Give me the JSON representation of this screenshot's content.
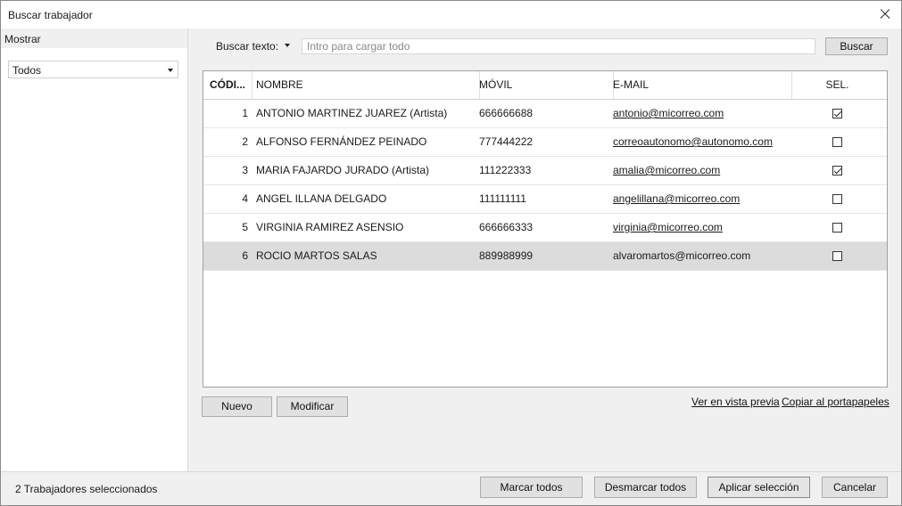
{
  "window": {
    "title": "Buscar trabajador"
  },
  "sidebar": {
    "heading": "Mostrar",
    "filter_value": "Todos"
  },
  "search": {
    "label": "Buscar texto:",
    "placeholder": "Intro para cargar todo",
    "button": "Buscar"
  },
  "table": {
    "headers": {
      "code": "CÓDI...",
      "name": "NOMBRE",
      "mobile": "MÓVIL",
      "email": "E-MAIL",
      "sel": "SEL."
    },
    "rows": [
      {
        "code": "1",
        "name": "ANTONIO MARTINEZ JUAREZ (Artista)",
        "mobile": "666666688",
        "email": "antonio@micorreo.com",
        "selected": true
      },
      {
        "code": "2",
        "name": "ALFONSO FERNÁNDEZ PEINADO",
        "mobile": "777444222",
        "email": "correoautonomo@autonomo.com",
        "selected": false
      },
      {
        "code": "3",
        "name": "MARIA FAJARDO JURADO (Artista)",
        "mobile": "111222333",
        "email": "amalia@micorreo.com",
        "selected": true
      },
      {
        "code": "4",
        "name": "ANGEL ILLANA DELGADO",
        "mobile": "111111111",
        "email": "angelillana@micorreo.com",
        "selected": false
      },
      {
        "code": "5",
        "name": "VIRGINIA RAMIREZ ASENSIO",
        "mobile": "666666333",
        "email": "virginia@micorreo.com",
        "selected": false
      },
      {
        "code": "6",
        "name": "ROCIO MARTOS SALAS",
        "mobile": "889988999",
        "email": "alvaromartos@micorreo.com",
        "selected": false
      }
    ]
  },
  "actions": {
    "new": "Nuevo",
    "modify": "Modificar",
    "preview": "Ver en vista previa",
    "copy": "Copiar al portapapeles"
  },
  "footer": {
    "status": "2 Trabajadores seleccionados",
    "mark_all": "Marcar todos",
    "unmark_all": "Desmarcar todos",
    "apply": "Aplicar selección",
    "cancel": "Cancelar"
  }
}
